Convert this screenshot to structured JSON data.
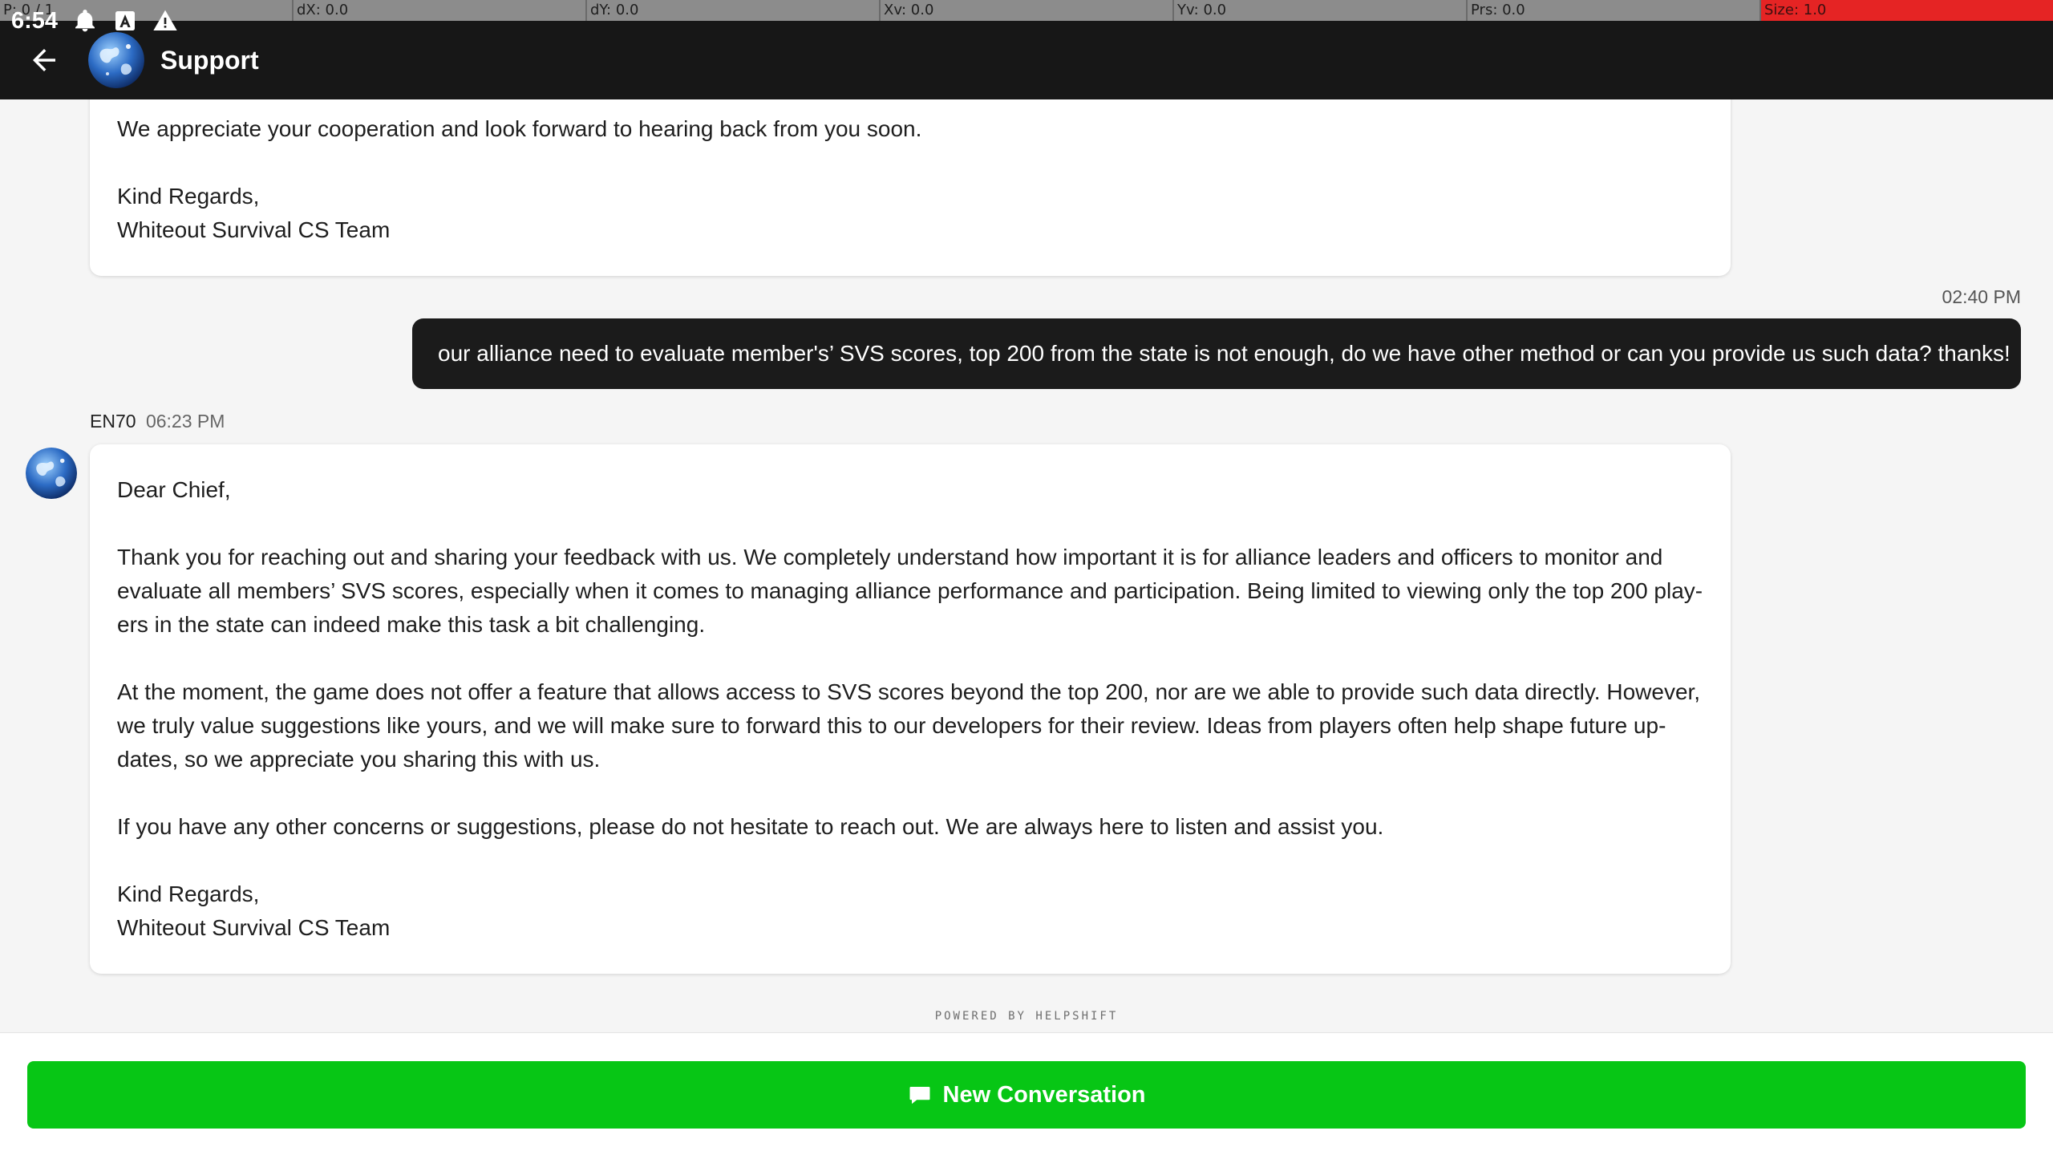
{
  "debug_bar": {
    "items": [
      "P: 0 / 1",
      "dX: 0.0",
      "dY: 0.0",
      "Xv: 0.0",
      "Yv: 0.0",
      "Prs: 0.0",
      "Size: 1.0"
    ]
  },
  "status_bar": {
    "time": "6:54",
    "icons": [
      "notification-bell-icon",
      "app-store-icon",
      "warning-icon"
    ]
  },
  "header": {
    "title": "Support",
    "back_icon": "arrow-left-icon",
    "avatar": "globe-avatar"
  },
  "messages": {
    "top_agent": {
      "paragraphs": [
        "We appreciate your cooperation and look forward to hearing back from you soon.",
        "Kind Regards,",
        "Whiteout Survival CS Team"
      ]
    },
    "user": {
      "time": "02:40 PM",
      "text": "our alliance need to evaluate member's’ SVS scores, top 200 from the state is not enough, do we have other method or can you provide us such data? thanks!"
    },
    "agent": {
      "sender": "EN70",
      "time": "06:23 PM",
      "paragraphs": [
        "Dear Chief,",
        "Thank you for reaching out and sharing your feedback with us. We completely understand how important it is for alliance leaders and officers to monitor and evaluate all members’ SVS scores, especially when it comes to managing alliance performance and participation. Being limited to viewing only the top 200 play-ers in the state can indeed make this task a bit challenging.",
        "At the moment, the game does not offer a feature that allows access to SVS scores beyond the top 200, nor are we able to provide such data directly. However, we truly value suggestions like yours, and we will make sure to forward this to our developers for their review. Ideas from players often help shape future up-dates, so we appreciate you sharing this with us.",
        "If you have any other concerns or suggestions, please do not hesitate to reach out. We are always here to listen and assist you.",
        "Kind Regards,",
        "Whiteout Survival CS Team"
      ]
    }
  },
  "powered_by": "POWERED BY HELPSHIFT",
  "footer": {
    "button_label": "New Conversation",
    "button_icon": "chat-bubble-icon"
  },
  "colors": {
    "header_bg": "#171717",
    "user_bubble": "#1b1b1b",
    "button_green": "#07c615",
    "debug_alert": "#e52424"
  }
}
